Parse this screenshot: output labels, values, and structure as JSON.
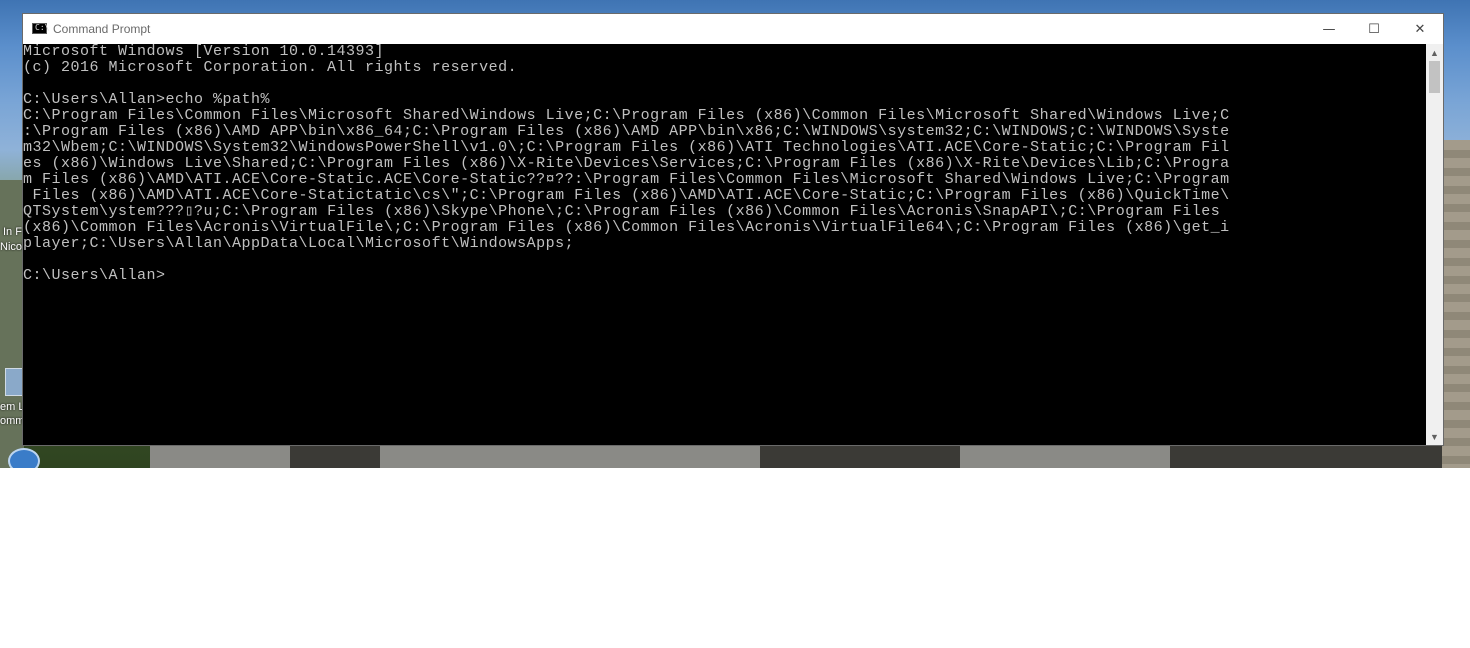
{
  "window": {
    "title": "Command Prompt",
    "icon_text": "C:\\",
    "controls": {
      "minimize": "—",
      "maximize": "☐",
      "close": "✕"
    }
  },
  "console": {
    "lines": [
      "Microsoft Windows [Version 10.0.14393]",
      "(c) 2016 Microsoft Corporation. All rights reserved.",
      "",
      "C:\\Users\\Allan>echo %path%",
      "C:\\Program Files\\Common Files\\Microsoft Shared\\Windows Live;C:\\Program Files (x86)\\Common Files\\Microsoft Shared\\Windows Live;C",
      ":\\Program Files (x86)\\AMD APP\\bin\\x86_64;C:\\Program Files (x86)\\AMD APP\\bin\\x86;C:\\WINDOWS\\system32;C:\\WINDOWS;C:\\WINDOWS\\Syste",
      "m32\\Wbem;C:\\WINDOWS\\System32\\WindowsPowerShell\\v1.0\\;C:\\Program Files (x86)\\ATI Technologies\\ATI.ACE\\Core-Static;C:\\Program Fil",
      "es (x86)\\Windows Live\\Shared;C:\\Program Files (x86)\\X-Rite\\Devices\\Services;C:\\Program Files (x86)\\X-Rite\\Devices\\Lib;C:\\Progra",
      "m Files (x86)\\AMD\\ATI.ACE\\Core-Static.ACE\\Core-Static??¤??:\\Program Files\\Common Files\\Microsoft Shared\\Windows Live;C:\\Program",
      " Files (x86)\\AMD\\ATI.ACE\\Core-Statictatic\\cs\\\";C:\\Program Files (x86)\\AMD\\ATI.ACE\\Core-Static;C:\\Program Files (x86)\\QuickTime\\",
      "QTSystem\\ystem???▯?u;C:\\Program Files (x86)\\Skype\\Phone\\;C:\\Program Files (x86)\\Common Files\\Acronis\\SnapAPI\\;C:\\Program Files",
      "(x86)\\Common Files\\Acronis\\VirtualFile\\;C:\\Program Files (x86)\\Common Files\\Acronis\\VirtualFile64\\;C:\\Program Files (x86)\\get_i",
      "player;C:\\Users\\Allan\\AppData\\Local\\Microsoft\\WindowsApps;",
      "",
      "C:\\Users\\Allan>"
    ]
  },
  "scrollbar": {
    "up_arrow": "▲",
    "down_arrow": "▼"
  },
  "desktop": {
    "labels": [
      "In F",
      "Nicol",
      "em L",
      "omm"
    ]
  }
}
